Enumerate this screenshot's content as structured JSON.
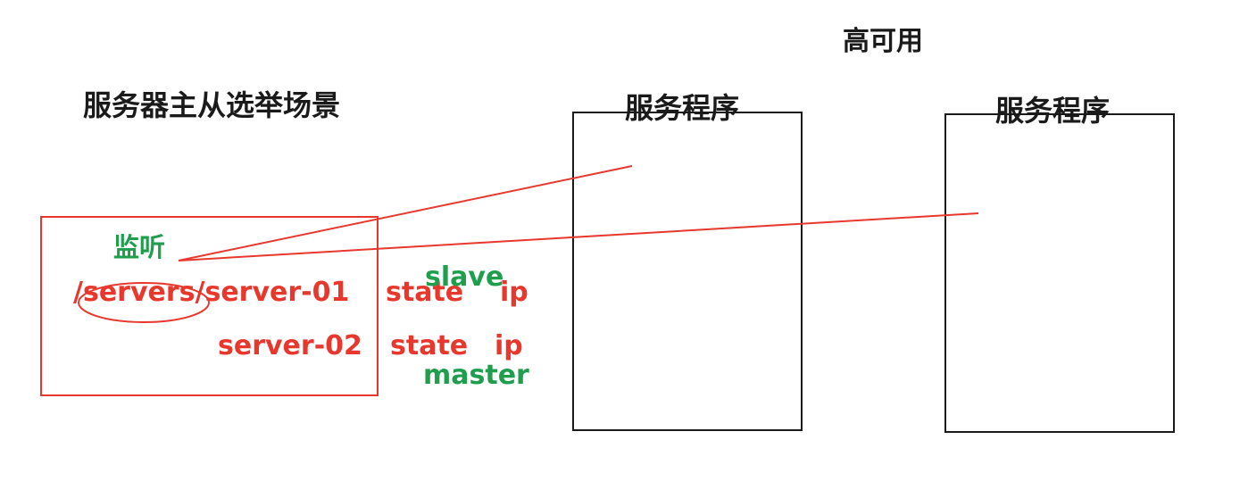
{
  "diagram": {
    "title_high_availability": "高可用",
    "title_scenario": "服务器主从选举场景",
    "service_a_label": "服务程序",
    "service_b_label": "服务程序",
    "listen_label": "监听",
    "server_01_path": "/servers/server-01",
    "server_02_name": "server-02",
    "server_01_state": "state",
    "server_01_ip": "ip",
    "server_01_role": "slave",
    "server_02_state": "state",
    "server_02_ip": "ip",
    "server_02_role": "master"
  },
  "colors": {
    "annotation_red": "#e8382e",
    "annotation_green": "#1f9e4e",
    "text_dark": "#1a1a1a",
    "box_border": "#1a1a1a"
  }
}
